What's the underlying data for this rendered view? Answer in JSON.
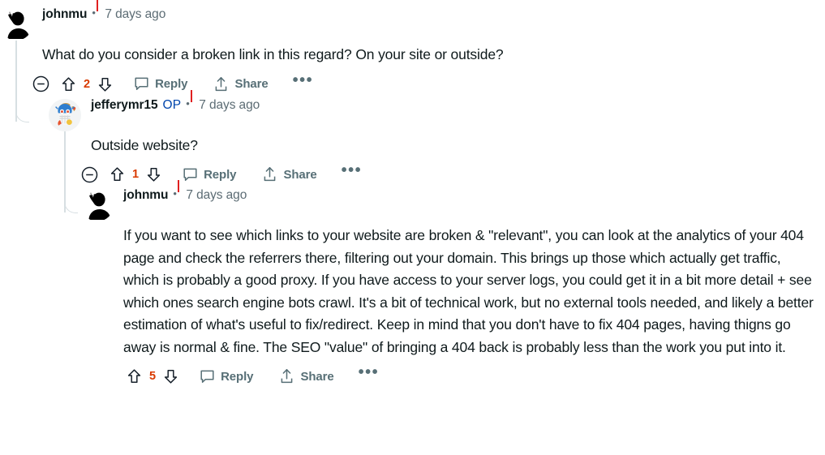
{
  "thread": {
    "comments": [
      {
        "id": "c1",
        "author": "johnmu",
        "op": false,
        "op_label": "",
        "timestamp": "7 days ago",
        "separator": "•",
        "avatar": "silhouette-waving-person",
        "text": "What do you consider a broken link in this regard? On your site or outside?",
        "votes": "2",
        "has_collapse": true,
        "actions": {
          "collapse_icon": "collapse-minus-circle-icon",
          "upvote_icon": "upvote-arrow-icon",
          "downvote_icon": "downvote-arrow-icon",
          "reply_icon": "comment-bubble-icon",
          "reply_label": "Reply",
          "share_icon": "share-arrow-icon",
          "share_label": "Share",
          "more_label": "•••"
        }
      },
      {
        "id": "c2",
        "author": "jefferymr15",
        "op": true,
        "op_label": "OP",
        "timestamp": "7 days ago",
        "separator": "•",
        "avatar": "snoo-avatar-blue-orange",
        "text": "Outside website?",
        "votes": "1",
        "has_collapse": true,
        "actions": {
          "collapse_icon": "collapse-minus-circle-icon",
          "upvote_icon": "upvote-arrow-icon",
          "downvote_icon": "downvote-arrow-icon",
          "reply_icon": "comment-bubble-icon",
          "reply_label": "Reply",
          "share_icon": "share-arrow-icon",
          "share_label": "Share",
          "more_label": "•••"
        }
      },
      {
        "id": "c3",
        "author": "johnmu",
        "op": false,
        "op_label": "",
        "timestamp": "7 days ago",
        "separator": "•",
        "avatar": "silhouette-waving-person",
        "text": "If you want to see which links to your website are broken & \"relevant\", you can look at the analytics of your 404 page and check the referrers there, filtering out your domain. This brings up those which actually get traffic, which is probably a good proxy. If you have access to your server logs, you could get it in a bit more detail + see which ones search engine bots crawl. It's a bit of technical work, but no external tools needed, and likely a better estimation of what's useful to fix/redirect. Keep in mind that you don't have to fix 404 pages, having thigns go away is normal & fine. The SEO \"value\" of bringing a 404 back is probably less than the work you put into it.",
        "votes": "5",
        "has_collapse": false,
        "actions": {
          "collapse_icon": "",
          "upvote_icon": "upvote-arrow-icon",
          "downvote_icon": "downvote-arrow-icon",
          "reply_icon": "comment-bubble-icon",
          "reply_label": "Reply",
          "share_icon": "share-arrow-icon",
          "share_label": "Share",
          "more_label": "•••"
        }
      }
    ]
  },
  "colors": {
    "text": "#0f1a1c",
    "muted": "#5c6c74",
    "action": "#576f76",
    "vote_orange": "#d93a00",
    "op_blue": "#0045ac",
    "thread_line": "#d7dfe2",
    "caret_red": "#e02020"
  }
}
